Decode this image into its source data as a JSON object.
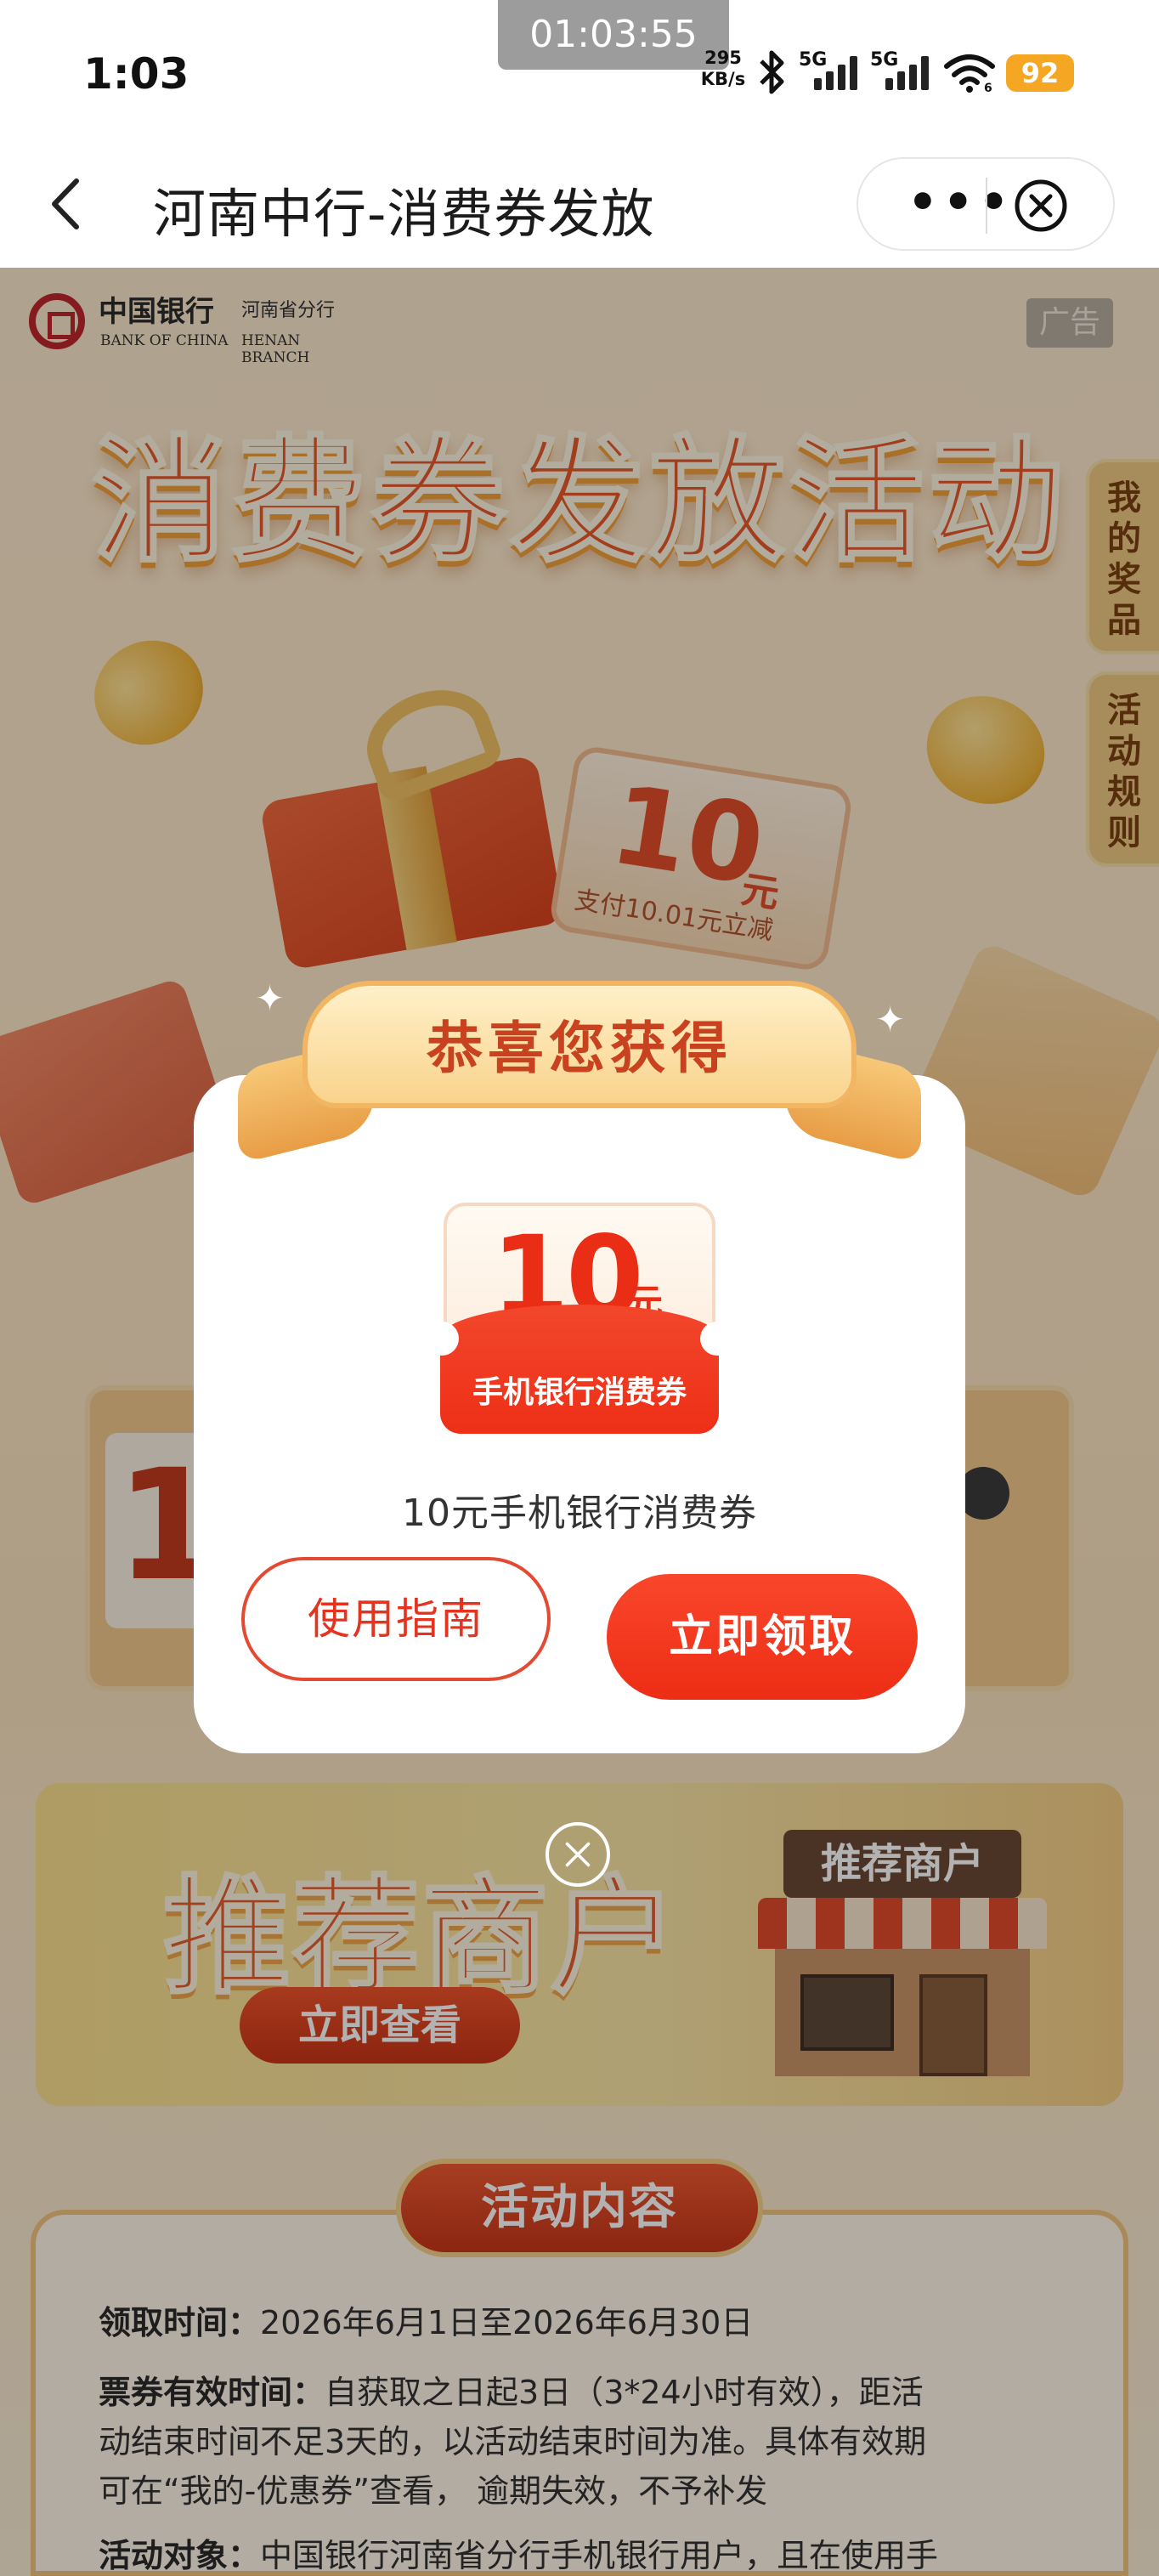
{
  "status_bar": {
    "time": "1:03",
    "recording_time": "01:03:55",
    "net_speed_value": "295",
    "net_speed_unit": "KB/s",
    "sim1_label": "5G",
    "sim2_label": "5G",
    "wifi_badge": "6",
    "battery": "92"
  },
  "nav": {
    "title": "河南中行-消费券发放",
    "more_label": "•••"
  },
  "page": {
    "logo_cn": "中国银行",
    "logo_cn_branch": "河南省分行",
    "logo_en": "BANK OF CHINA",
    "logo_en_branch": "HENAN BRANCH",
    "ad_badge": "广告",
    "headline": "消费券发放活动",
    "side_tabs": [
      "我的奖品",
      "活动规则"
    ],
    "bg_coupon_value": "10",
    "bg_coupon_unit": "元",
    "bg_coupon_desc": "支付10.01元立减",
    "bg_card_digit": "1",
    "banner_title": "推荐商户",
    "banner_cta": "立即查看",
    "banner_sign": "推荐商户",
    "section_title": "活动内容",
    "rules": [
      {
        "label": "领取时间：",
        "text": "2026年6月1日至2026年6月30日"
      },
      {
        "label": "票券有效时间：",
        "text": "自获取之日起3日（3*24小时有效），距活"
      },
      {
        "label": "",
        "text": "动结束时间不足3天的，以活动结束时间为准。具体有效期"
      },
      {
        "label": "",
        "text": "可在“我的-优惠券”查看， 逾期失效，不予补发"
      },
      {
        "label": "活动对象：",
        "text": "中国银行河南省分行手机银行用户，且在使用手"
      }
    ]
  },
  "modal": {
    "ribbon_text": "恭喜您获得",
    "coupon_value": "10",
    "coupon_unit": "元",
    "coupon_label": "手机银行消费券",
    "coupon_name": "10元手机银行消费券",
    "guide_button": "使用指南",
    "claim_button": "立即领取"
  },
  "colors": {
    "accent_red": "#ed2d15",
    "ribbon_gold": "#f9d38c",
    "page_bg": "#fbe6c6",
    "overlay": "rgba(0,0,0,0.30)"
  }
}
